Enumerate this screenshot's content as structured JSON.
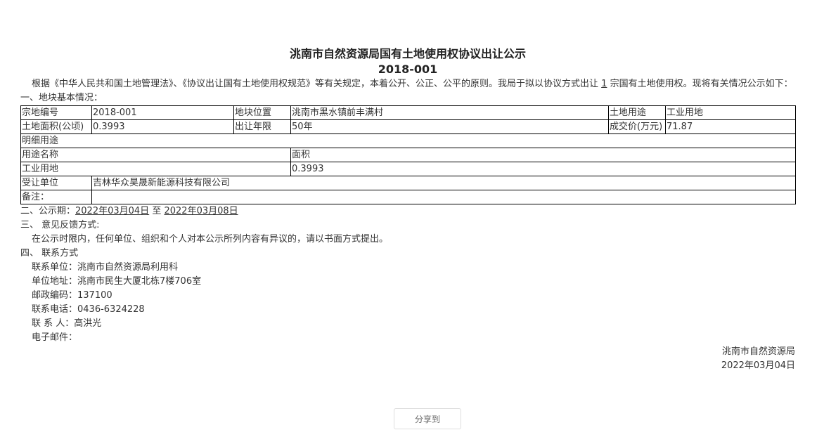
{
  "title": "洮南市自然资源局国有土地使用权协议出让公示",
  "code": "2018-001",
  "intro_pre": "根据《中华人民共和国土地管理法》、《协议出让国有土地使用权规范》等有关规定，本着公开、公正、公平的原则。我局于拟以协议方式出让",
  "intro_count": "1",
  "intro_post": "宗国有土地使用权。现将有关情况公示如下：",
  "section1": "一、地块基本情况：",
  "table": {
    "parcel_no_label": "宗地编号",
    "parcel_no": "2018-001",
    "location_label": "地块位置",
    "location": "洮南市黑水镇前丰满村",
    "use_label": "土地用途",
    "use": "工业用地",
    "area_label": "土地面积(公顷)",
    "area": "0.3993",
    "term_label": "出让年限",
    "term": "50年",
    "price_label": "成交价(万元)",
    "price": "71.87",
    "detail_label": "明细用途",
    "use_name_label": "用途名称",
    "detail_area_label": "面积",
    "detail_use": "工业用地",
    "detail_area": "0.3993",
    "grantee_label": "受让单位",
    "grantee": "吉林华众昊晟新能源科技有限公司",
    "remark_label": "备注："
  },
  "section2_label": "二、公示期：",
  "period_start": "2022年03月04日",
  "period_to": "至",
  "period_end": "2022年03月08日",
  "section3": "三、 意见反馈方式:",
  "feedback": "在公示时限内，任何单位、组织和个人对本公示所列内容有异议的，请以书面方式提出。",
  "section4": "四、 联系方式",
  "contact": {
    "unit": "联系单位：洮南市自然资源局利用科",
    "address": "单位地址：洮南市民生大厦北栋7楼706室",
    "postcode": "邮政编码：137100",
    "phone": "联系电话：0436-6324228",
    "person": "联 系 人：高洪光",
    "email": "电子邮件："
  },
  "signature": "洮南市自然资源局",
  "sign_date": "2022年03月04日",
  "share_label": "分享到"
}
